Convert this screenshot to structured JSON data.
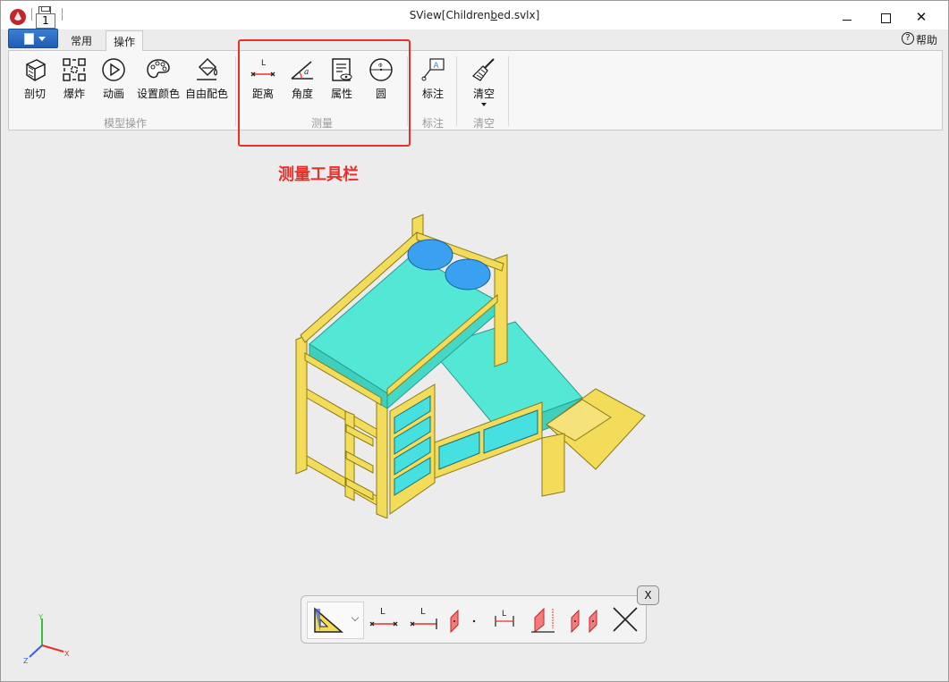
{
  "window": {
    "title_prefix": "SView[Children",
    "title_underlined": "b",
    "title_suffix": "ed.svlx]",
    "keytip": "1"
  },
  "help": {
    "label": "帮助",
    "icon_char": "?"
  },
  "tabs": [
    {
      "label": "常用",
      "active": false
    },
    {
      "label": "操作",
      "active": true
    }
  ],
  "ribbon": {
    "groups": [
      {
        "name": "模型操作",
        "buttons": [
          "剖切",
          "爆炸",
          "动画",
          "设置颜色",
          "自由配色"
        ]
      },
      {
        "name": "测量",
        "buttons": [
          "距离",
          "角度",
          "属性",
          "圆"
        ]
      },
      {
        "name": "标注",
        "buttons": [
          "标注"
        ]
      },
      {
        "name": "清空",
        "buttons": [
          "清空"
        ]
      }
    ]
  },
  "annotation": {
    "text": "测量工具栏",
    "color": "#e8302b"
  },
  "measure_toolbar": {
    "close_label": "X",
    "tools": [
      "distance-point-point",
      "distance-line",
      "plane",
      "point",
      "dimension",
      "plane-angle",
      "plane-pair",
      "cancel"
    ]
  },
  "axis": {
    "x": "X",
    "y": "Y",
    "z": "Z"
  },
  "colors": {
    "accent_red": "#e8302b",
    "mattress": "#52e8d5",
    "wood": "#f2dc5a",
    "pillow": "#3aa0f0"
  },
  "icon_glyphs": {
    "close": "✕",
    "x_mark": "X"
  }
}
